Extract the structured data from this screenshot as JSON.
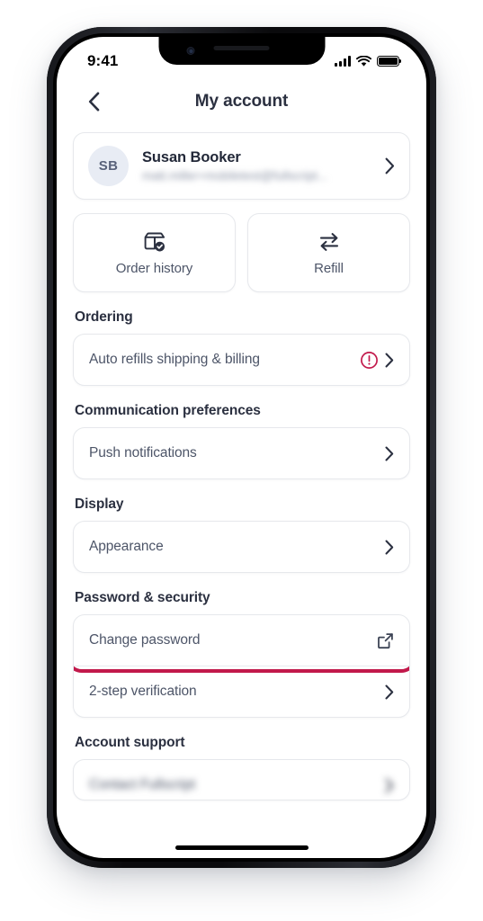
{
  "status_bar": {
    "time": "9:41",
    "signal_icon": "cellular-bars-icon",
    "wifi_icon": "wifi-icon",
    "battery_icon": "battery-full-icon"
  },
  "navbar": {
    "back_icon": "chevron-left-icon",
    "title": "My account"
  },
  "profile": {
    "initials": "SB",
    "name": "Susan Booker",
    "email": "matt.miller+mobiletest@fullscript...",
    "chevron_icon": "chevron-right-icon"
  },
  "quick_actions": [
    {
      "label": "Order history",
      "icon": "package-check-icon"
    },
    {
      "label": "Refill",
      "icon": "swap-arrows-icon"
    }
  ],
  "sections": [
    {
      "title": "Ordering",
      "rows": [
        {
          "label": "Auto refills shipping & billing",
          "alert_icon": "alert-circle-icon",
          "trailing_icon": "chevron-right-icon",
          "highlighted": false
        }
      ]
    },
    {
      "title": "Communication preferences",
      "rows": [
        {
          "label": "Push notifications",
          "trailing_icon": "chevron-right-icon",
          "highlighted": false
        }
      ]
    },
    {
      "title": "Display",
      "rows": [
        {
          "label": "Appearance",
          "trailing_icon": "chevron-right-icon",
          "highlighted": false
        }
      ]
    },
    {
      "title": "Password & security",
      "rows": [
        {
          "label": "Change password",
          "trailing_icon": "external-link-icon",
          "highlighted": true
        },
        {
          "label": "2-step verification",
          "trailing_icon": "chevron-right-icon",
          "highlighted": false
        }
      ]
    },
    {
      "title": "Account support",
      "rows": [
        {
          "label": "Contact Fullscript",
          "trailing_icon": "chevron-right-icon",
          "highlighted": false,
          "cut_off": true
        }
      ]
    }
  ],
  "colors": {
    "highlight": "#c2194b",
    "alert": "#c2194b",
    "heading": "#2b3040",
    "body_text": "#4d5568",
    "card_border": "#e6e8ec",
    "avatar_bg": "#e8ecf4"
  },
  "home_indicator": "home-indicator-bar"
}
